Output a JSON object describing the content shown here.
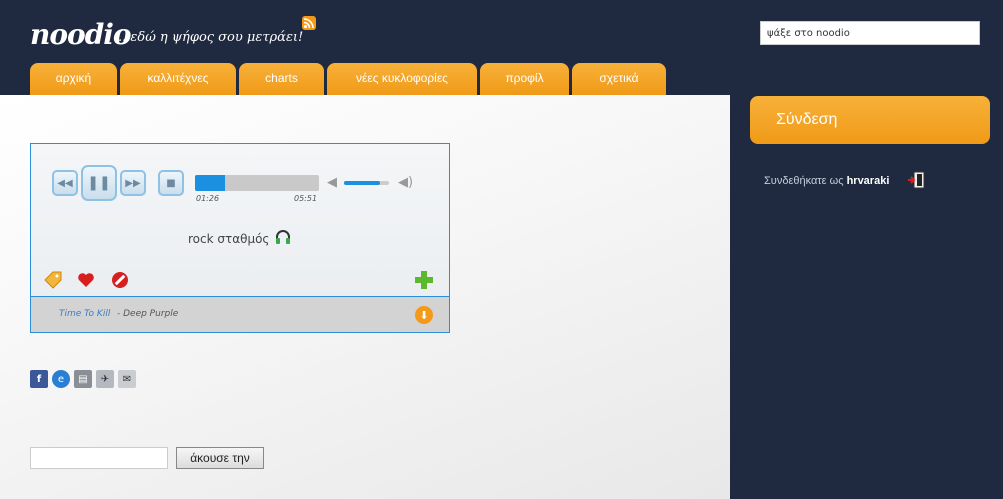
{
  "header": {
    "logo": "noodio",
    "tagline": "...εδώ η ψήφος σου μετράει!",
    "search_placeholder": "ψάξε στο noodio",
    "rss_icon": "rss-icon"
  },
  "nav": {
    "tabs": [
      {
        "label": "αρχική"
      },
      {
        "label": "καλλιτέχνες"
      },
      {
        "label": "charts"
      },
      {
        "label": "νέες κυκλοφορίες"
      },
      {
        "label": "προφίλ"
      },
      {
        "label": "σχετικά"
      }
    ]
  },
  "player": {
    "elapsed": "01:26",
    "duration": "05:51",
    "progress_fraction": 0.245,
    "volume_fraction": 0.8,
    "station": "rock σταθμός",
    "track_title": "Time To Kill",
    "track_artist": "- Deep Purple",
    "accent_color": "#1b8fe0"
  },
  "listen": {
    "button_label": "άκουσε την"
  },
  "sidebar": {
    "login_label": "Σύνδεση",
    "logged_in_text": "Συνδεθήκατε ως",
    "username": "hrvaraki"
  },
  "colors": {
    "background": "#1f2a40",
    "orange": "#f09a17"
  }
}
